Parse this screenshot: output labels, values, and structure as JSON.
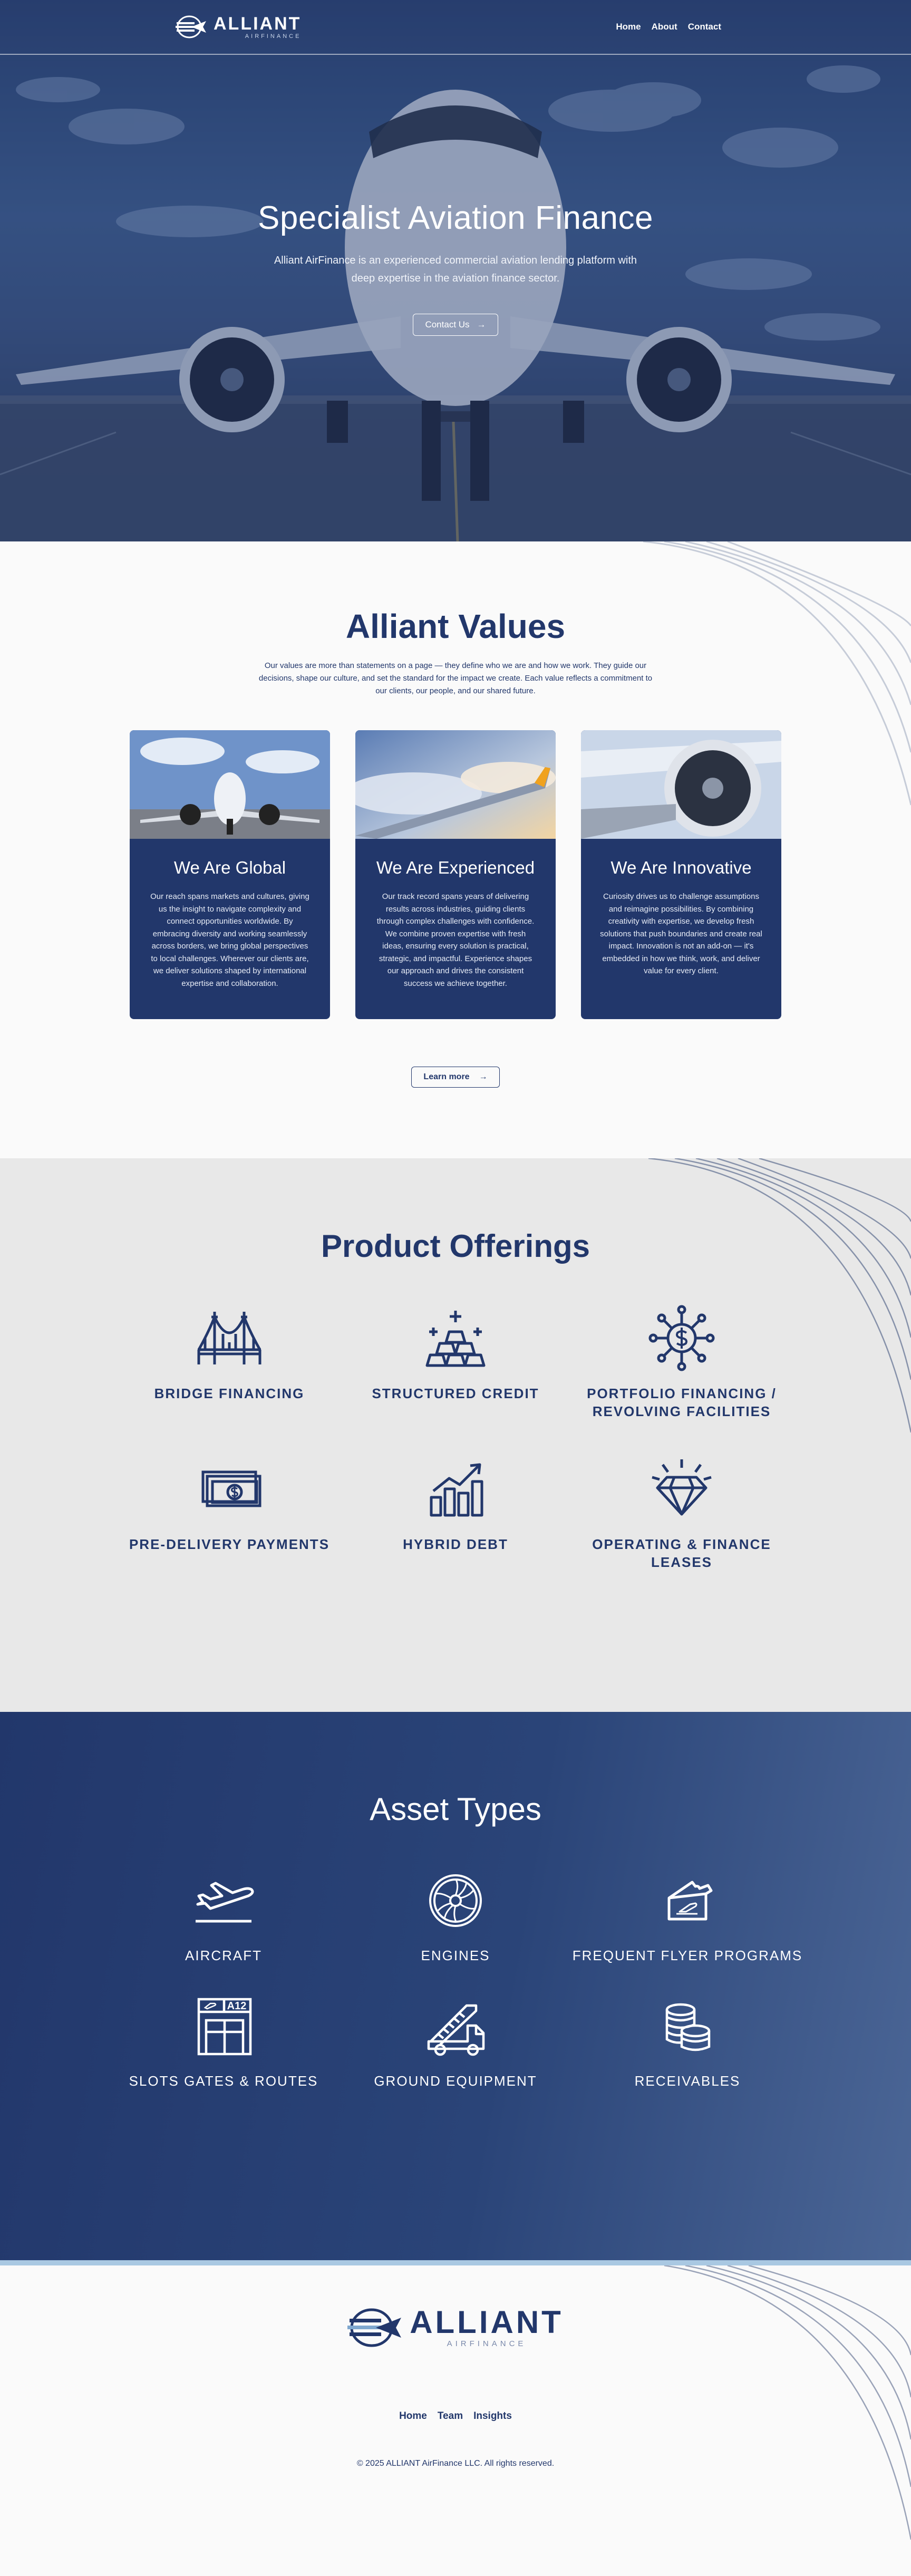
{
  "nav": {
    "logo_name": "ALLIANT",
    "logo_sub": "AIRFINANCE",
    "links": [
      "Home",
      "About",
      "Contact"
    ]
  },
  "hero": {
    "title": "Specialist Aviation Finance",
    "description": "Alliant AirFinance is an experienced commercial aviation lending platform with deep expertise in the aviation finance sector.",
    "button_label": "Contact Us",
    "button_arrow": "→"
  },
  "values": {
    "title": "Alliant Values",
    "intro": "Our values are more than statements on a page — they define who we are and how we work. They guide our decisions, shape our culture, and set the standard for the impact we create. Each value reflects a commitment to our clients, our people, and our shared future.",
    "cards": [
      {
        "title": "We Are Global",
        "text": "Our reach spans markets and cultures, giving us the insight to navigate complexity and connect opportunities worldwide. By embracing diversity and working seamlessly across borders, we bring global perspectives to local challenges. Wherever our clients are, we deliver solutions shaped by international expertise and collaboration."
      },
      {
        "title": "We Are Experienced",
        "text": "Our track record spans years of delivering results across industries, guiding clients through complex challenges with confidence. We combine proven expertise with fresh ideas, ensuring every solution is practical, strategic, and impactful.  Experience shapes our approach and drives the consistent success we achieve together."
      },
      {
        "title": "We Are Innovative",
        "text": "Curiosity drives us to challenge assumptions and reimagine possibilities. By combining creativity with expertise, we develop fresh solutions that push boundaries and create real impact. Innovation is not an add-on — it's embedded in how we think, work, and deliver value for every client."
      }
    ],
    "button_label": "Learn more",
    "button_arrow": "→"
  },
  "products": {
    "title": "Product Offerings",
    "items": [
      {
        "label": "BRIDGE FINANCING",
        "icon": "bridge-icon"
      },
      {
        "label": "STRUCTURED CREDIT",
        "icon": "gold-bars-icon"
      },
      {
        "label": "PORTFOLIO FINANCING / REVOLVING FACILITIES",
        "icon": "dollar-network-icon"
      },
      {
        "label": "PRE-DELIVERY PAYMENTS",
        "icon": "cash-icon"
      },
      {
        "label": "HYBRID DEBT",
        "icon": "growth-chart-icon"
      },
      {
        "label": "OPERATING & FINANCE LEASES",
        "icon": "diamond-icon"
      }
    ]
  },
  "assets": {
    "title": "Asset Types",
    "items": [
      {
        "label": "AIRCRAFT",
        "icon": "plane-takeoff-icon"
      },
      {
        "label": "ENGINES",
        "icon": "engine-icon"
      },
      {
        "label": "FREQUENT FLYER PROGRAMS",
        "icon": "ticket-icon"
      },
      {
        "label": "SLOTS GATES & ROUTES",
        "icon": "gate-icon",
        "sign": "A12"
      },
      {
        "label": "GROUND EQUIPMENT",
        "icon": "stair-truck-icon"
      },
      {
        "label": "RECEIVABLES",
        "icon": "coins-icon"
      }
    ]
  },
  "footer": {
    "logo_name": "ALLIANT",
    "logo_sub": "AIRFINANCE",
    "links": [
      "Home",
      "Team",
      "Insights"
    ],
    "copyright": "© 2025 ALLIANT AirFinance LLC. All rights reserved."
  },
  "colors": {
    "navy": "#22376b",
    "light_bg": "#fafafa",
    "grey_bg": "#e8e8e8",
    "footer_rule": "#a9c8e2"
  }
}
